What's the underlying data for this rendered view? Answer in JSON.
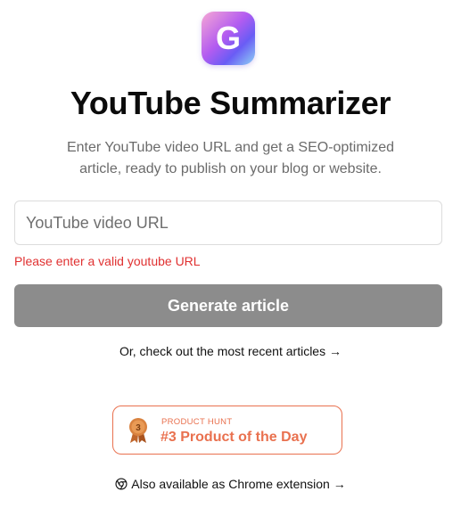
{
  "app": {
    "logo_letter": "G",
    "title": "YouTube Summarizer",
    "subtitle_line1": "Enter YouTube video URL and get a SEO-optimized",
    "subtitle_line2": "article, ready to publish on your blog or website."
  },
  "form": {
    "url_placeholder": "YouTube video URL",
    "url_value": "",
    "error_message": "Please enter a valid youtube URL",
    "submit_label": "Generate article"
  },
  "links": {
    "recent_articles": "Or, check out the most recent articles →",
    "chrome_extension": "Also available as Chrome extension →"
  },
  "product_hunt": {
    "label": "PRODUCT HUNT",
    "rank_text": "#3 Product of the Day",
    "medal_number": "3"
  },
  "colors": {
    "error": "#e03131",
    "button_disabled": "#8c8c8c",
    "product_hunt_accent": "#e9714f"
  },
  "icons": {
    "logo": "g-logo-icon",
    "medal": "bronze-medal-icon",
    "chrome": "chrome-icon"
  }
}
